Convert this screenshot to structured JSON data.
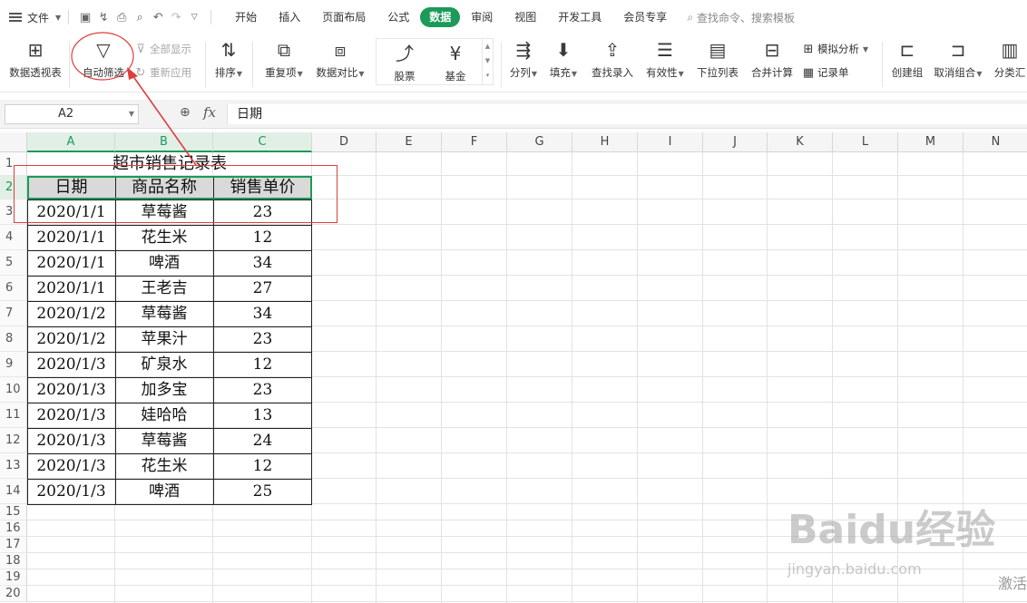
{
  "menubar": {
    "file_label": "文件",
    "tabs": [
      "开始",
      "插入",
      "页面布局",
      "公式",
      "数据",
      "审阅",
      "视图",
      "开发工具",
      "会员专享"
    ],
    "active_tab": "数据",
    "search_placeholder": "查找命令、搜索模板"
  },
  "ribbon": {
    "pivot": "数据透视表",
    "autofilter": "自动筛选",
    "show_all": "全部显示",
    "reapply": "重新应用",
    "sort": "排序",
    "duplicates": "重复项",
    "compare": "数据对比",
    "stock": "股票",
    "fund": "基金",
    "split": "分列",
    "fill": "填充",
    "lookup": "查找录入",
    "validity": "有效性",
    "dropdown": "下拉列表",
    "consolidate": "合并计算",
    "whatif": "模拟分析",
    "record": "记录单",
    "group": "创建组",
    "ungroup": "取消组合",
    "subtotal": "分类汇"
  },
  "formula_bar": {
    "name_box": "A2",
    "fx": "fx",
    "value": "日期"
  },
  "sheet": {
    "columns": [
      "A",
      "B",
      "C",
      "D",
      "E",
      "F",
      "G",
      "H",
      "I",
      "J",
      "K",
      "L",
      "M",
      "N"
    ],
    "rows": [
      "1",
      "2",
      "3",
      "4",
      "5",
      "6",
      "7",
      "8",
      "9",
      "10",
      "11",
      "12",
      "13",
      "14",
      "15",
      "16",
      "17",
      "18",
      "19",
      "20"
    ],
    "title": "超市销售记录表",
    "headers": [
      "日期",
      "商品名称",
      "销售单价"
    ],
    "data": [
      [
        "2020/1/1",
        "草莓酱",
        "23"
      ],
      [
        "2020/1/1",
        "花生米",
        "12"
      ],
      [
        "2020/1/1",
        "啤酒",
        "34"
      ],
      [
        "2020/1/1",
        "王老吉",
        "27"
      ],
      [
        "2020/1/2",
        "草莓酱",
        "34"
      ],
      [
        "2020/1/2",
        "苹果汁",
        "23"
      ],
      [
        "2020/1/3",
        "矿泉水",
        "12"
      ],
      [
        "2020/1/3",
        "加多宝",
        "23"
      ],
      [
        "2020/1/3",
        "娃哈哈",
        "13"
      ],
      [
        "2020/1/3",
        "草莓酱",
        "24"
      ],
      [
        "2020/1/3",
        "花生米",
        "12"
      ],
      [
        "2020/1/3",
        "啤酒",
        "25"
      ]
    ]
  },
  "watermark": {
    "brand": "Baidu经验",
    "url": "jingyan.baidu.com",
    "activate": "激活"
  },
  "colors": {
    "accent": "#1b9a59",
    "annotation": "#e03c3c"
  }
}
